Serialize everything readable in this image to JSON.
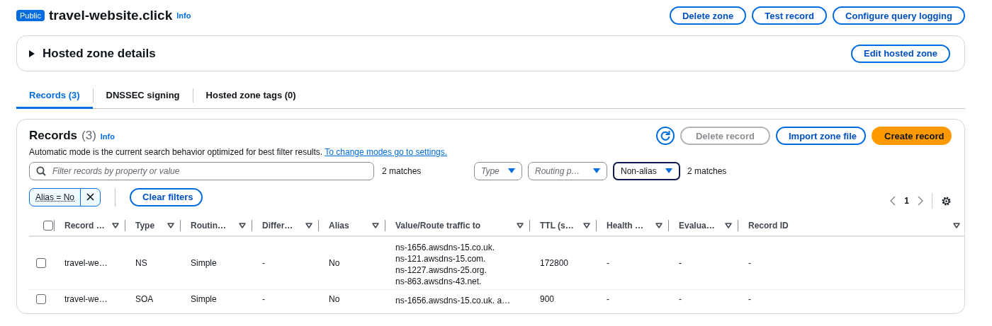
{
  "header": {
    "badge": "Public",
    "title": "travel-website.click",
    "info": "Info",
    "buttons": [
      "Delete zone",
      "Test record",
      "Configure query logging"
    ]
  },
  "hosted_zone_details": {
    "title": "Hosted zone details",
    "expanded": false,
    "button": "Edit hosted zone"
  },
  "tabs": [
    {
      "label": "Records (3)",
      "selected": true
    },
    {
      "label": "DNSSEC signing",
      "selected": false
    },
    {
      "label": "Hosted zone tags (0)",
      "selected": false
    }
  ],
  "records_panel": {
    "title": "Records",
    "count": "(3)",
    "info": "Info",
    "description": "Automatic mode is the current search behavior optimized for best filter results.",
    "link": "To change modes go to settings.",
    "buttons": [
      {
        "label": "Delete record",
        "kind": "normal",
        "disabled": true
      },
      {
        "label": "Import zone file",
        "kind": "normal",
        "disabled": false
      },
      {
        "label": "Create record",
        "kind": "primary",
        "disabled": false
      }
    ],
    "search": {
      "placeholder": "Filter records by property or value"
    },
    "search_matches": "2 matches",
    "filters": [
      {
        "label": "Type",
        "kind": "placeholder"
      },
      {
        "label": "Routing p…",
        "kind": "placeholder"
      },
      {
        "label": "Non-alias",
        "kind": "value"
      }
    ],
    "filter_matches": "2 matches",
    "tokens": [
      "Alias = No"
    ],
    "clear_filters": "Clear filters",
    "page": "1"
  },
  "table": {
    "select_all": {
      "checked": false
    },
    "columns": [
      "Record …",
      "Type",
      "Routin…",
      "Differ…",
      "Alias",
      "Value/Route traffic to",
      "TTL (s…",
      "Health …",
      "Evalua…",
      "Record ID"
    ],
    "rows": [
      {
        "selected": false,
        "cells": [
          "travel-we…",
          "NS",
          "Simple",
          "-",
          "No",
          [
            "ns-1656.awsdns-15.co.uk.",
            "ns-121.awsdns-15.com.",
            "ns-1227.awsdns-25.org.",
            "ns-863.awsdns-43.net."
          ],
          "172800",
          "-",
          "-",
          "-"
        ]
      },
      {
        "selected": false,
        "cells": [
          "travel-we…",
          "SOA",
          "Simple",
          "-",
          "No",
          [
            "ns-1656.awsdns-15.co.uk. a…"
          ],
          "900",
          "-",
          "-",
          "-"
        ]
      }
    ]
  }
}
